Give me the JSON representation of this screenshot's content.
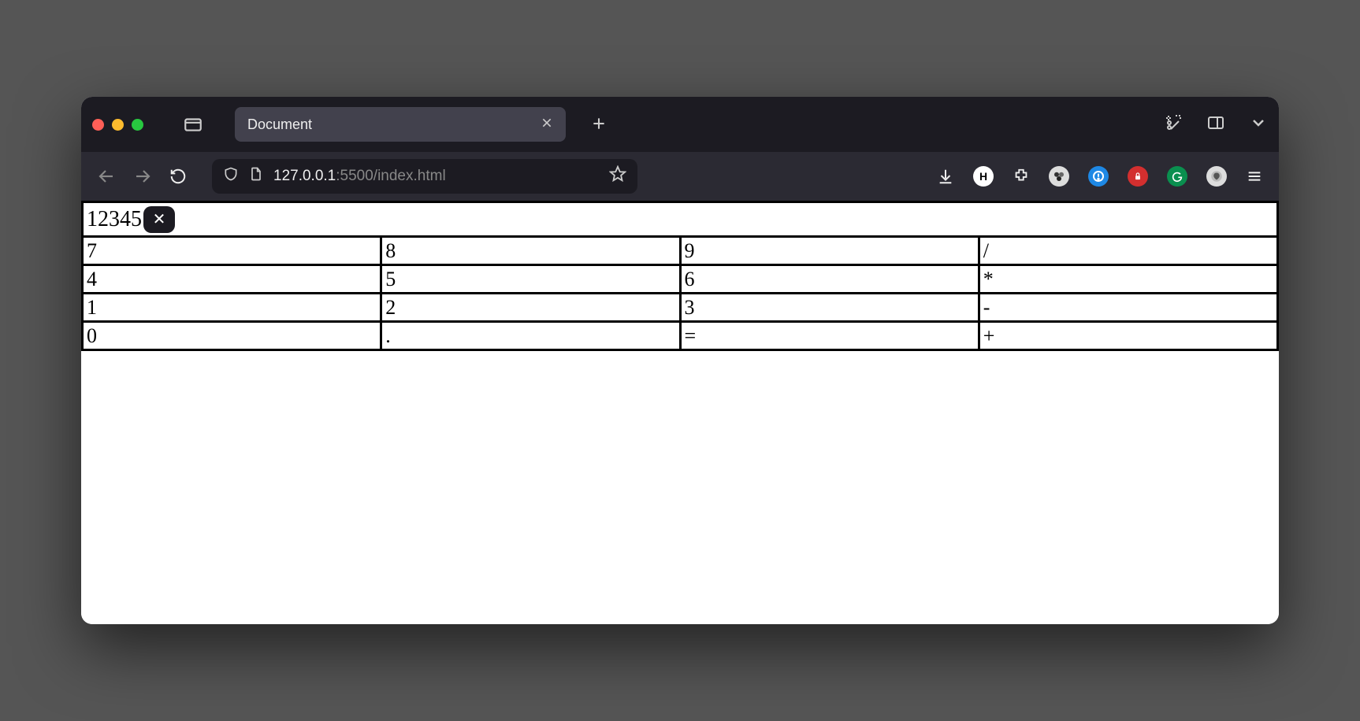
{
  "window": {
    "tab_title": "Document",
    "url_host": "127.0.0.1",
    "url_path": ":5500/index.html"
  },
  "calculator": {
    "display": "12345",
    "clear_glyph": "✕",
    "rows": [
      [
        "7",
        "8",
        "9",
        "/"
      ],
      [
        "4",
        "5",
        "6",
        "*"
      ],
      [
        "1",
        "2",
        "3",
        "-"
      ],
      [
        "0",
        ".",
        "=",
        "+"
      ]
    ]
  }
}
